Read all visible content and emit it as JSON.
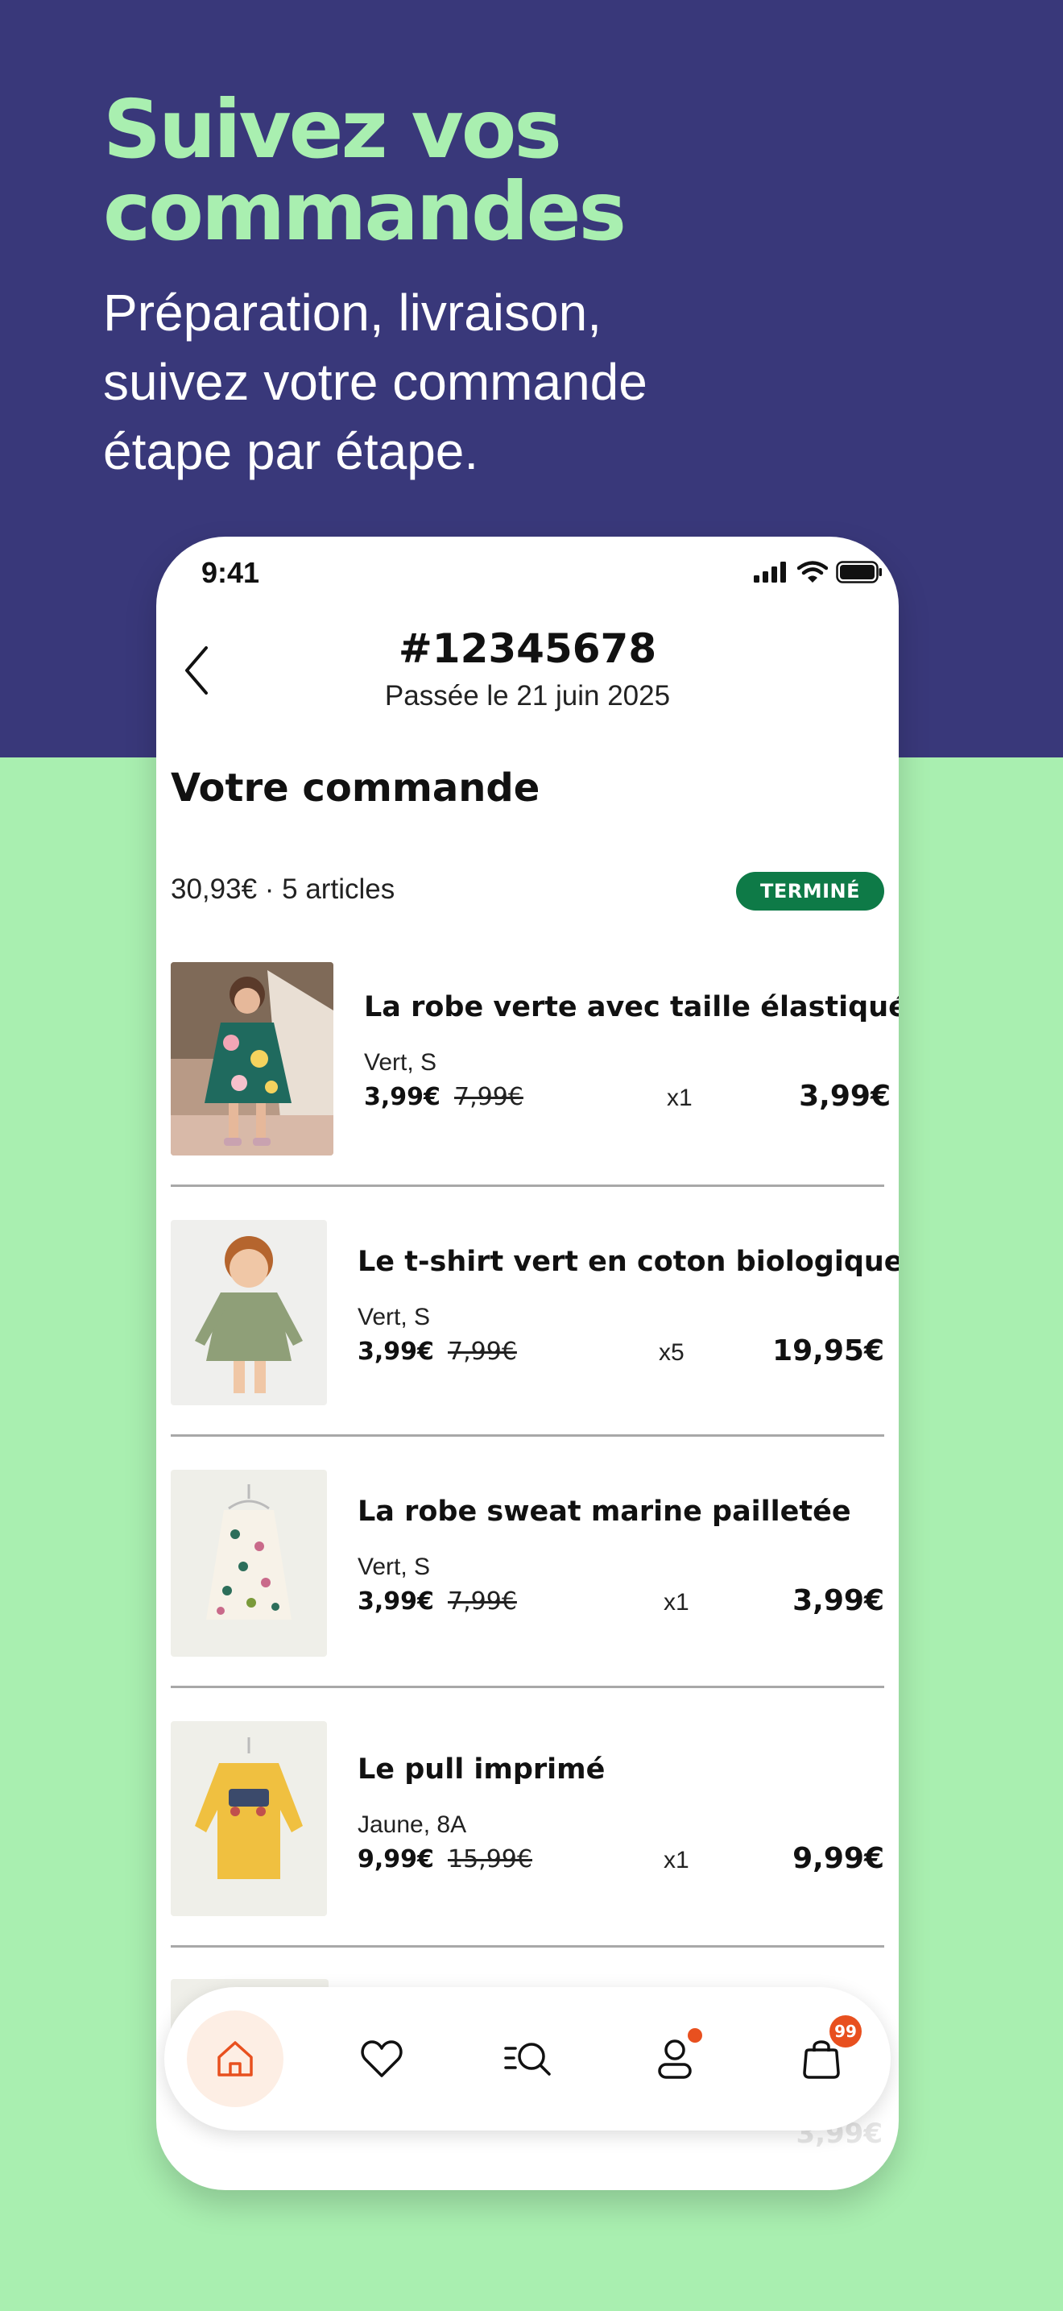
{
  "promo": {
    "headline_line1": "Suivez vos",
    "headline_line2": "commandes",
    "sub_line1": "Préparation, livraison,",
    "sub_line2": "suivez votre commande",
    "sub_line3": "étape par étape."
  },
  "status_bar": {
    "time": "9:41"
  },
  "header": {
    "order_number": "#12345678",
    "order_date": "Passée le 21 juin 2025"
  },
  "order": {
    "section_title": "Votre commande",
    "summary": "30,93€ · 5 articles",
    "status": "TERMINÉ",
    "items": [
      {
        "name": "La robe verte avec taille élastiquée...",
        "variant": "Vert, S",
        "price": "3,99€",
        "old_price": "7,99€",
        "qty": "x1",
        "total": "3,99€"
      },
      {
        "name": "Le t-shirt vert en coton biologique...",
        "variant": "Vert, S",
        "price": "3,99€",
        "old_price": "7,99€",
        "qty": "x5",
        "total": "19,95€"
      },
      {
        "name": "La robe sweat marine pailletée",
        "variant": "Vert, S",
        "price": "3,99€",
        "old_price": "7,99€",
        "qty": "x1",
        "total": "3,99€"
      },
      {
        "name": "Le pull imprimé",
        "variant": "Jaune, 8A",
        "price": "9,99€",
        "old_price": "15,99€",
        "qty": "x1",
        "total": "9,99€"
      }
    ],
    "partial_total": "3,99€"
  },
  "tabbar": {
    "active": "home",
    "cart_count": "99",
    "icons": [
      "home-icon",
      "heart-icon",
      "search-list-icon",
      "user-icon",
      "bag-icon"
    ]
  },
  "colors": {
    "brand_navy": "#39387a",
    "brand_mint": "#a9efb0",
    "status_green": "#0e7a47",
    "accent_orange": "#e8501f"
  }
}
